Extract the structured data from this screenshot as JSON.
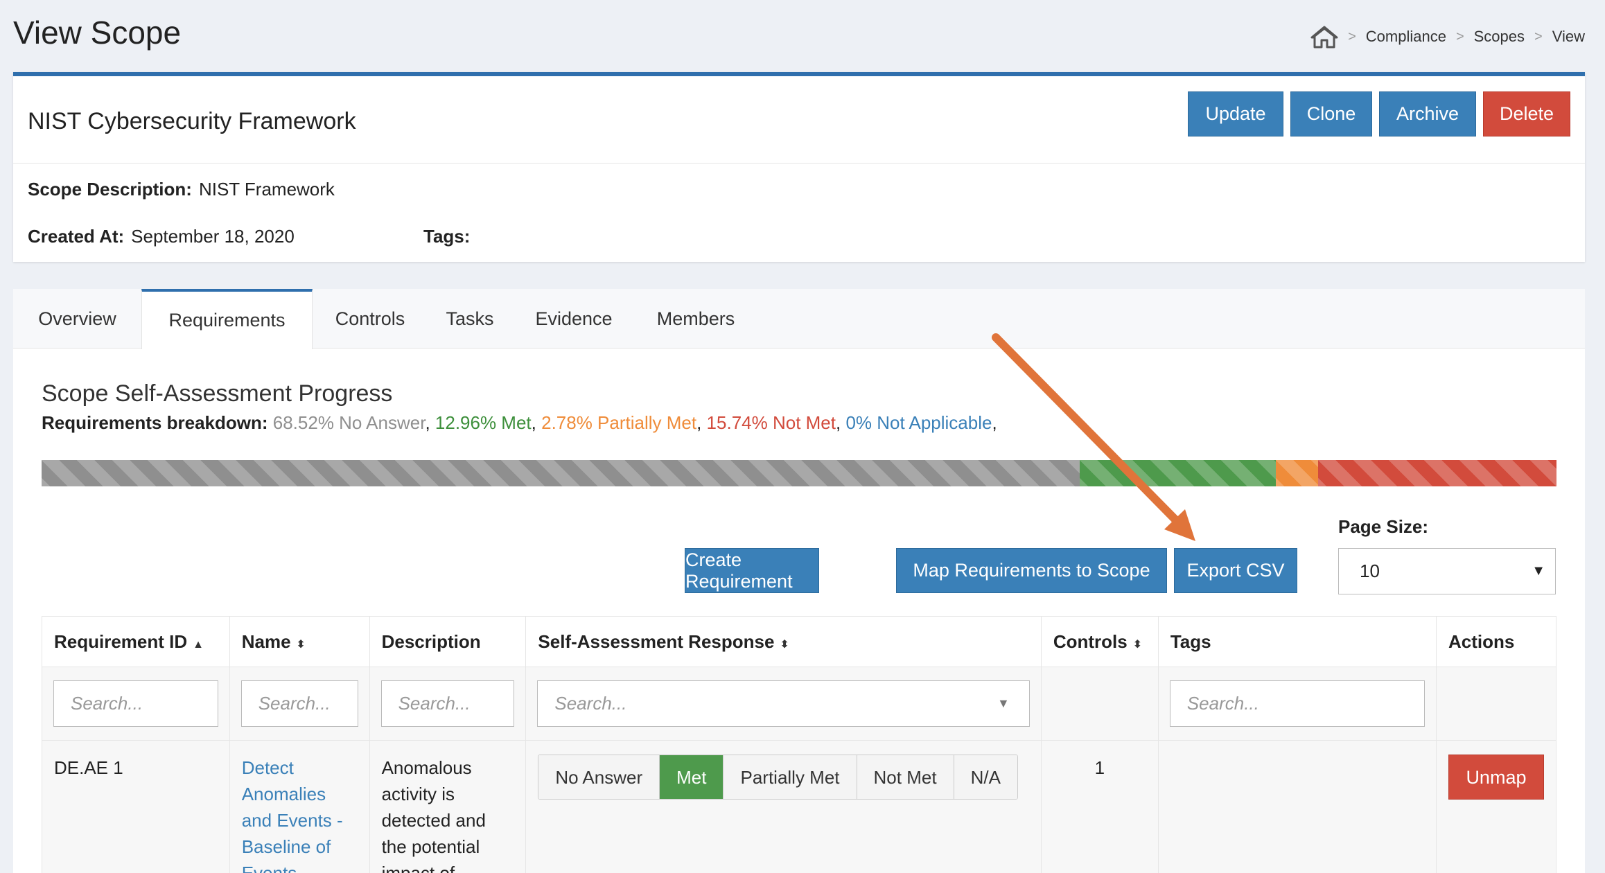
{
  "page": {
    "title": "View Scope"
  },
  "breadcrumb": {
    "items": [
      "Compliance",
      "Scopes",
      "View"
    ],
    "separator": ">"
  },
  "scope": {
    "name": "NIST Cybersecurity Framework",
    "description_label": "Scope Description:",
    "description": "NIST Framework",
    "created_label": "Created At:",
    "created": "September 18, 2020",
    "tags_label": "Tags:"
  },
  "actions": {
    "update": "Update",
    "clone": "Clone",
    "archive": "Archive",
    "delete": "Delete"
  },
  "tabs": [
    "Overview",
    "Requirements",
    "Controls",
    "Tasks",
    "Evidence",
    "Members"
  ],
  "active_tab": "Requirements",
  "progress": {
    "title": "Scope Self-Assessment Progress",
    "breakdown_label": "Requirements breakdown:",
    "items": [
      {
        "text": "68.52% No Answer",
        "value": 68.52,
        "color": "#8f8f8f"
      },
      {
        "text": "12.96% Met",
        "value": 12.96,
        "color": "#4e9a4c"
      },
      {
        "text": "2.78% Partially Met",
        "value": 2.78,
        "color": "#ef8c3a"
      },
      {
        "text": "15.74% Not Met",
        "value": 15.74,
        "color": "#d24b3c"
      },
      {
        "text": "0% Not Applicable",
        "value": 0,
        "color": "#3a80b8"
      }
    ]
  },
  "toolbar": {
    "create": "Create Requirement",
    "map": "Map Requirements to Scope",
    "export": "Export CSV",
    "page_size_label": "Page Size:",
    "page_size_value": "10"
  },
  "table": {
    "columns": [
      "Requirement ID",
      "Name",
      "Description",
      "Self-Assessment Response",
      "Controls",
      "Tags",
      "Actions"
    ],
    "search_placeholder": "Search...",
    "rows": [
      {
        "id": "DE.AE 1",
        "name": "Detect Anomalies and Events - Baseline of Events",
        "description": "Anomalous activity is detected and the potential impact of",
        "responses": [
          "No Answer",
          "Met",
          "Partially Met",
          "Not Met",
          "N/A"
        ],
        "selected_response": "Met",
        "controls": "1",
        "action": "Unmap"
      }
    ]
  },
  "annotation": {
    "arrow_color": "#e0743a"
  }
}
